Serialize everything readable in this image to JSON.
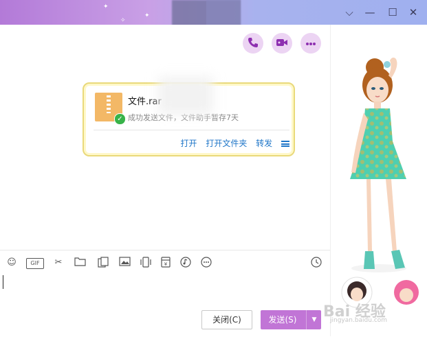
{
  "window": {
    "title_controls": [
      "chevron-down",
      "minimize",
      "maximize",
      "close"
    ]
  },
  "top_actions": [
    {
      "icon": "phone-icon"
    },
    {
      "icon": "video-icon"
    },
    {
      "icon": "more-icon"
    }
  ],
  "message": {
    "file_name": "文件.rar",
    "status": "成功发送文件，文件助手暂存7天",
    "actions": {
      "open": "打开",
      "open_folder": "打开文件夹",
      "forward": "转发"
    }
  },
  "toolbar": {
    "gif_label": "GIF",
    "icons": [
      "emoji-icon",
      "gif-icon",
      "scissors-icon",
      "folder-icon",
      "image-collection-icon",
      "image-icon",
      "shake-icon",
      "red-packet-icon",
      "music-icon",
      "more-tools-icon",
      "history-icon"
    ]
  },
  "buttons": {
    "close": "关闭(C)",
    "send": "发送(S)"
  },
  "watermark": {
    "brand": "Bai 经验",
    "url": "jingyan.baidu.com"
  },
  "colors": {
    "accent": "#c175d6",
    "link": "#1f76c8",
    "card_border": "#e9d97a",
    "success": "#38b349"
  }
}
